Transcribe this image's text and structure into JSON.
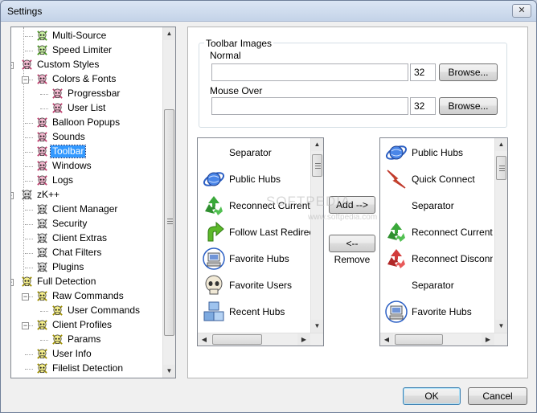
{
  "window": {
    "title": "Settings",
    "close_glyph": "✕"
  },
  "tree": {
    "nodes": [
      {
        "label": "Multi-Source",
        "depth": 2,
        "icon": "green-skull-icon",
        "selected": false,
        "expander": ""
      },
      {
        "label": "Speed Limiter",
        "depth": 2,
        "icon": "green-skull-icon",
        "selected": false,
        "expander": ""
      },
      {
        "label": "Custom Styles",
        "depth": 1,
        "icon": "pink-skull-icon",
        "selected": false,
        "expander": "−"
      },
      {
        "label": "Colors & Fonts",
        "depth": 2,
        "icon": "pink-skull-icon",
        "selected": false,
        "expander": "−"
      },
      {
        "label": "Progressbar",
        "depth": 3,
        "icon": "pink-skull-icon",
        "selected": false,
        "expander": ""
      },
      {
        "label": "User List",
        "depth": 3,
        "icon": "pink-skull-icon",
        "selected": false,
        "expander": ""
      },
      {
        "label": "Balloon Popups",
        "depth": 2,
        "icon": "pink-skull-icon",
        "selected": false,
        "expander": ""
      },
      {
        "label": "Sounds",
        "depth": 2,
        "icon": "pink-skull-icon",
        "selected": false,
        "expander": ""
      },
      {
        "label": "Toolbar",
        "depth": 2,
        "icon": "pink-skull-icon",
        "selected": true,
        "expander": ""
      },
      {
        "label": "Windows",
        "depth": 2,
        "icon": "pink-skull-icon",
        "selected": false,
        "expander": ""
      },
      {
        "label": "Logs",
        "depth": 2,
        "icon": "pink-skull-icon",
        "selected": false,
        "expander": ""
      },
      {
        "label": "zK++",
        "depth": 1,
        "icon": "gray-skull-icon",
        "selected": false,
        "expander": "−"
      },
      {
        "label": "Client Manager",
        "depth": 2,
        "icon": "gray-skull-icon",
        "selected": false,
        "expander": ""
      },
      {
        "label": "Security",
        "depth": 2,
        "icon": "gray-skull-icon",
        "selected": false,
        "expander": ""
      },
      {
        "label": "Client Extras",
        "depth": 2,
        "icon": "gray-skull-icon",
        "selected": false,
        "expander": ""
      },
      {
        "label": "Chat Filters",
        "depth": 2,
        "icon": "gray-skull-icon",
        "selected": false,
        "expander": ""
      },
      {
        "label": "Plugins",
        "depth": 2,
        "icon": "gray-skull-icon",
        "selected": false,
        "expander": ""
      },
      {
        "label": "Full Detection",
        "depth": 1,
        "icon": "yellow-skull-icon",
        "selected": false,
        "expander": "−"
      },
      {
        "label": "Raw Commands",
        "depth": 2,
        "icon": "yellow-skull-icon",
        "selected": false,
        "expander": "−"
      },
      {
        "label": "User Commands",
        "depth": 3,
        "icon": "yellow-skull-icon",
        "selected": false,
        "expander": ""
      },
      {
        "label": "Client Profiles",
        "depth": 2,
        "icon": "yellow-skull-icon",
        "selected": false,
        "expander": "−"
      },
      {
        "label": "Params",
        "depth": 3,
        "icon": "yellow-skull-icon",
        "selected": false,
        "expander": ""
      },
      {
        "label": "User Info",
        "depth": 2,
        "icon": "yellow-skull-icon",
        "selected": false,
        "expander": ""
      },
      {
        "label": "Filelist Detection",
        "depth": 2,
        "icon": "yellow-skull-icon",
        "selected": false,
        "expander": ""
      }
    ]
  },
  "toolbar_images": {
    "group_label": "Toolbar Images",
    "normal_label": "Normal",
    "normal_path": "",
    "normal_size": "32",
    "mouse_over_label": "Mouse Over",
    "mouse_over_path": "",
    "mouse_over_size": "32",
    "browse_label": "Browse..."
  },
  "available_list": [
    {
      "label": "Separator",
      "icon": ""
    },
    {
      "label": "Public Hubs",
      "icon": "globe-icon"
    },
    {
      "label": "Reconnect Current Hub",
      "icon": "green-recycle-icon"
    },
    {
      "label": "Follow Last Redirect",
      "icon": "green-arrow-icon"
    },
    {
      "label": "Favorite Hubs",
      "icon": "computer-icon"
    },
    {
      "label": "Favorite Users",
      "icon": "skull-icon"
    },
    {
      "label": "Recent Hubs",
      "icon": "cubes-icon"
    }
  ],
  "toolbar_list": [
    {
      "label": "Public Hubs",
      "icon": "globe-icon"
    },
    {
      "label": "Quick Connect",
      "icon": "lightning-icon"
    },
    {
      "label": "Separator",
      "icon": ""
    },
    {
      "label": "Reconnect Current Hub",
      "icon": "green-recycle-icon"
    },
    {
      "label": "Reconnect Disconnected",
      "icon": "red-recycle-icon"
    },
    {
      "label": "Separator",
      "icon": ""
    },
    {
      "label": "Favorite Hubs",
      "icon": "computer-icon"
    }
  ],
  "actions": {
    "add_label": "Add -->",
    "remove_label": "<-- Remove"
  },
  "footer": {
    "ok_label": "OK",
    "cancel_label": "Cancel"
  },
  "watermark": {
    "text": "SOFTPEDIA",
    "url": "www.softpedia.com"
  },
  "colors": {
    "selection": "#3399ff",
    "window_bg": "#f0f0f0"
  }
}
